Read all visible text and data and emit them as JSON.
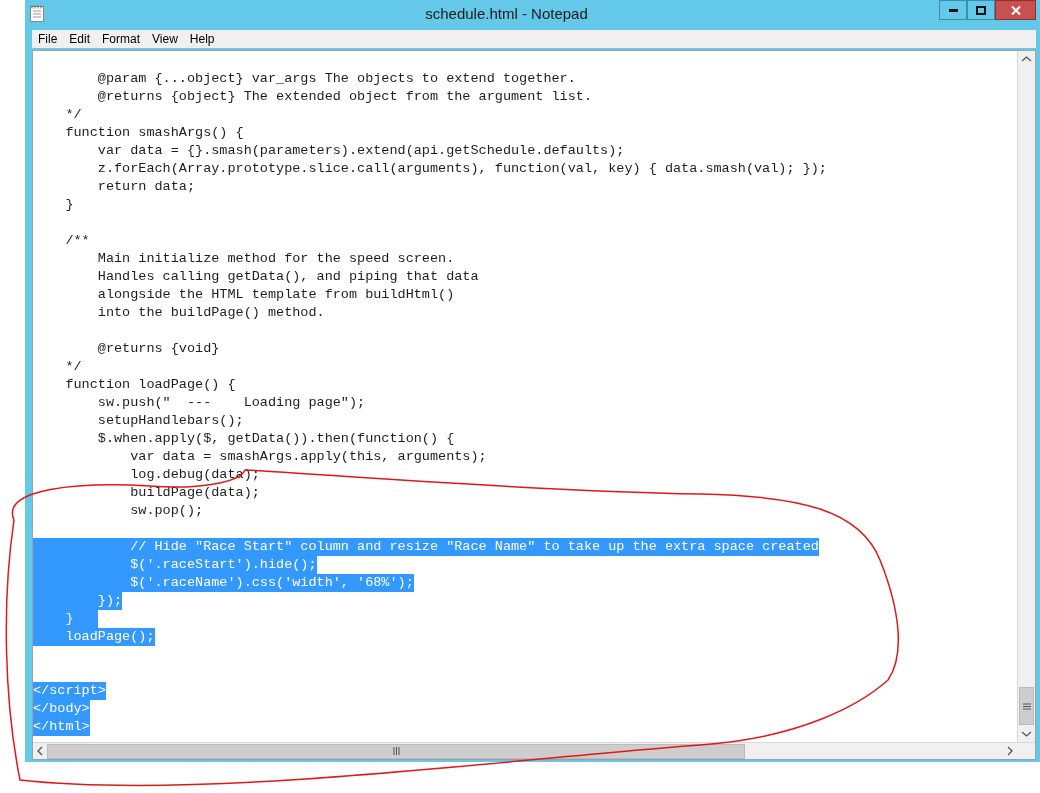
{
  "window": {
    "title": "schedule.html - Notepad"
  },
  "menu": [
    "File",
    "Edit",
    "Format",
    "View",
    "Help"
  ],
  "lines": [
    {
      "kind": "code",
      "text": "        @param {...object} var_args The objects to extend together.",
      "selected": false
    },
    {
      "kind": "code",
      "text": "        @returns {object} The extended object from the argument list.",
      "selected": false
    },
    {
      "kind": "code",
      "text": "    */",
      "selected": false
    },
    {
      "kind": "code",
      "text": "    function smashArgs() {",
      "selected": false
    },
    {
      "kind": "code",
      "text": "        var data = {}.smash(parameters).extend(api.getSchedule.defaults);",
      "selected": false
    },
    {
      "kind": "code",
      "text": "        z.forEach(Array.prototype.slice.call(arguments), function(val, key) { data.smash(val); });",
      "selected": false
    },
    {
      "kind": "code",
      "text": "        return data;",
      "selected": false
    },
    {
      "kind": "code",
      "text": "    }",
      "selected": false
    },
    {
      "kind": "blank"
    },
    {
      "kind": "code",
      "text": "    /**",
      "selected": false
    },
    {
      "kind": "code",
      "text": "        Main initialize method for the speed screen.",
      "selected": false
    },
    {
      "kind": "code",
      "text": "        Handles calling getData(), and piping that data",
      "selected": false
    },
    {
      "kind": "code",
      "text": "        alongside the HTML template from buildHtml()",
      "selected": false
    },
    {
      "kind": "code",
      "text": "        into the buildPage() method.",
      "selected": false
    },
    {
      "kind": "blank"
    },
    {
      "kind": "code",
      "text": "        @returns {void}",
      "selected": false
    },
    {
      "kind": "code",
      "text": "    */",
      "selected": false
    },
    {
      "kind": "code",
      "text": "    function loadPage() {",
      "selected": false
    },
    {
      "kind": "code",
      "text": "        sw.push(\"  ---    Loading page\");",
      "selected": false
    },
    {
      "kind": "code",
      "text": "        setupHandlebars();",
      "selected": false
    },
    {
      "kind": "code",
      "text": "        $.when.apply($, getData()).then(function() {",
      "selected": false
    },
    {
      "kind": "code",
      "text": "            var data = smashArgs.apply(this, arguments);",
      "selected": false
    },
    {
      "kind": "code",
      "text": "            log.debug(data);",
      "selected": false
    },
    {
      "kind": "code",
      "text": "            buildPage(data);",
      "selected": false
    },
    {
      "kind": "code",
      "text": "            sw.pop();",
      "selected": false
    },
    {
      "kind": "blank"
    },
    {
      "kind": "code",
      "text": "            // Hide \"Race Start\" column and resize \"Race Name\" to take up the extra space created",
      "selected": true
    },
    {
      "kind": "code",
      "text": "            $('.raceStart').hide();",
      "selected": true
    },
    {
      "kind": "code",
      "text": "            $('.raceName').css('width', '68%');",
      "selected": true
    },
    {
      "kind": "code",
      "text": "        });",
      "selected": true
    },
    {
      "kind": "code",
      "text": "    }   ",
      "selected": true
    },
    {
      "kind": "code",
      "text": "    loadPage();",
      "selected": true
    },
    {
      "kind": "blank"
    },
    {
      "kind": "blank"
    },
    {
      "kind": "code",
      "text": "</script>",
      "selected": true
    },
    {
      "kind": "code",
      "text": "</body>",
      "selected": true
    },
    {
      "kind": "code",
      "text": "</html>",
      "selected": true
    }
  ]
}
